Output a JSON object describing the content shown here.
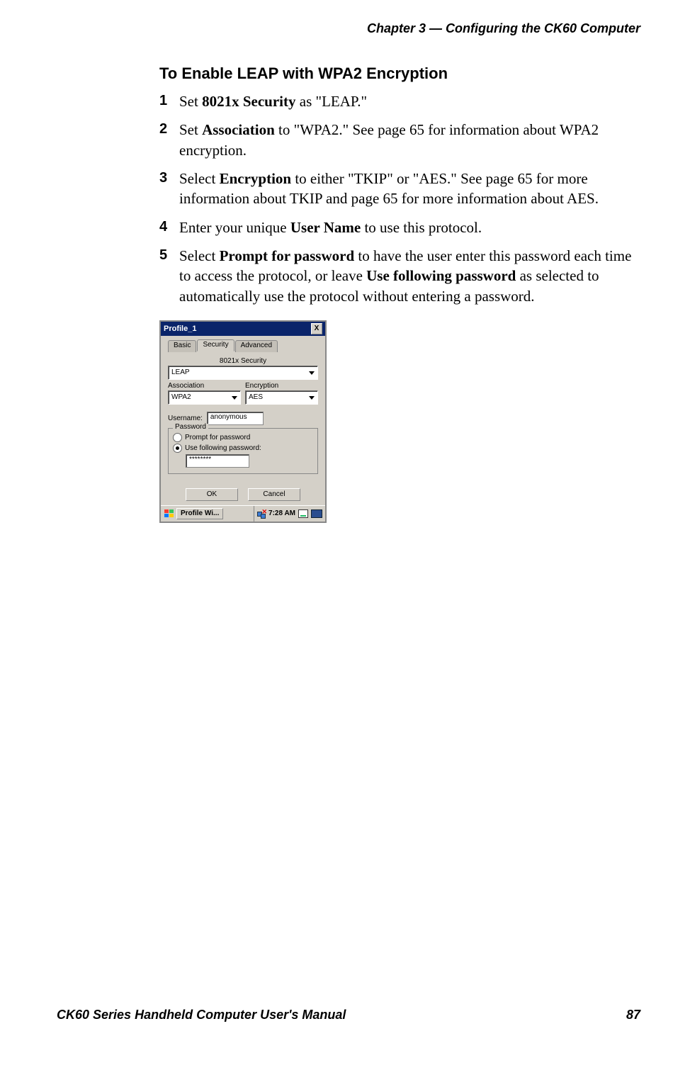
{
  "header": "Chapter 3 —  Configuring the CK60 Computer",
  "heading": "To Enable LEAP with WPA2 Encryption",
  "steps": [
    {
      "num": "1",
      "t1": "Set ",
      "b1": "8021x Security",
      "t2": " as \"LEAP.\""
    },
    {
      "num": "2",
      "t1": "Set ",
      "b1": "Association",
      "t2": " to \"WPA2.\" See page 65 for information about WPA2 encryption."
    },
    {
      "num": "3",
      "t1": "Select ",
      "b1": "Encryption",
      "t2": " to either \"TKIP\" or \"AES.\" See page 65 for more information about TKIP and page 65 for more information about AES."
    },
    {
      "num": "4",
      "t1": "Enter your unique ",
      "b1": "User Name",
      "t2": " to use this protocol."
    },
    {
      "num": "5",
      "t1": "Select ",
      "b1": "Prompt for password",
      "t2": " to have the user enter this password each time to access the protocol, or leave ",
      "b2": "Use following password",
      "t3": " as selected to automatically use the protocol without entering a password."
    }
  ],
  "dialog": {
    "title": "Profile_1",
    "close": "X",
    "tabs": {
      "basic": "Basic",
      "security": "Security",
      "advanced": "Advanced"
    },
    "sec_label": "8021x Security",
    "sec_value": "LEAP",
    "assoc_label": "Association",
    "assoc_value": "WPA2",
    "enc_label": "Encryption",
    "enc_value": "AES",
    "username_label": "Username:",
    "username_value": "anonymous",
    "password_legend": "Password",
    "radio_prompt": "Prompt for password",
    "radio_use": "Use following password:",
    "password_value": "********",
    "ok": "OK",
    "cancel": "Cancel"
  },
  "taskbar": {
    "app": "Profile Wi...",
    "time": "7:28 AM"
  },
  "footer": {
    "left": "CK60 Series Handheld Computer User's Manual",
    "right": "87"
  }
}
